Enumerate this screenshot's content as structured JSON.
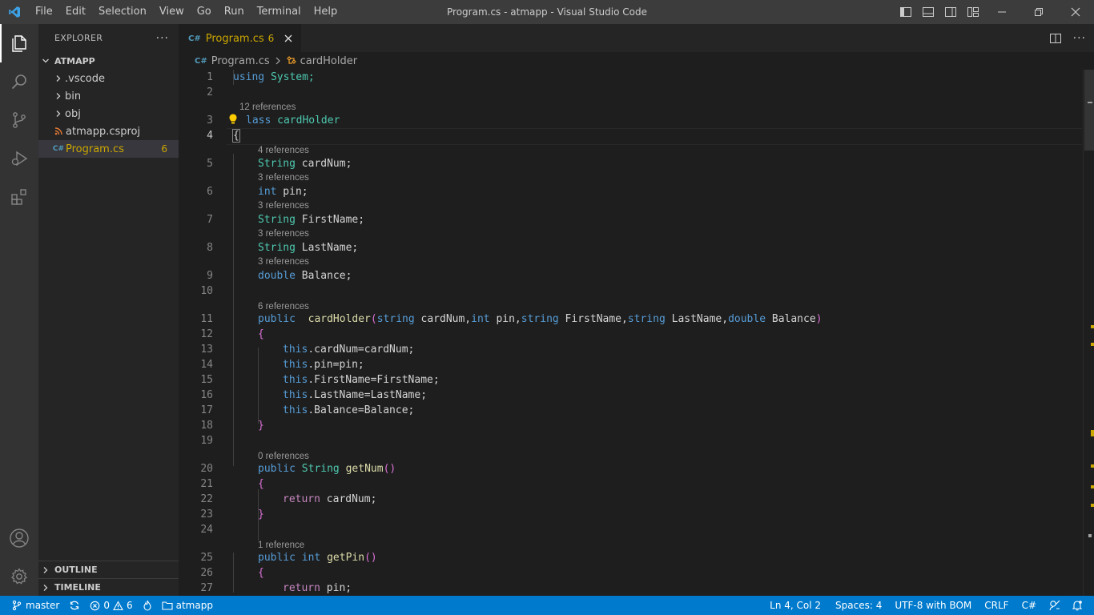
{
  "window": {
    "title": "Program.cs - atmapp - Visual Studio Code",
    "menu": [
      "File",
      "Edit",
      "Selection",
      "View",
      "Go",
      "Run",
      "Terminal",
      "Help"
    ]
  },
  "sidebar": {
    "header": "EXPLORER",
    "more": "···",
    "root": "ATMAPP",
    "items": [
      {
        "label": ".vscode",
        "type": "folder"
      },
      {
        "label": "bin",
        "type": "folder"
      },
      {
        "label": "obj",
        "type": "folder"
      },
      {
        "label": "atmapp.csproj",
        "type": "file",
        "icon": "rss-icon"
      },
      {
        "label": "Program.cs",
        "type": "file",
        "icon": "csharp-icon",
        "badge": "6",
        "selected": true
      }
    ],
    "outline": "OUTLINE",
    "timeline": "TIMELINE"
  },
  "editor": {
    "tab": {
      "icon": "C#",
      "label": "Program.cs",
      "badge": "6"
    },
    "breadcrumb": {
      "icon": "C#",
      "file": "Program.cs",
      "symbol": "cardHolder"
    },
    "lens": {
      "l3": "12 references",
      "l5": "4 references",
      "l6": "3 references",
      "l7": "3 references",
      "l8": "3 references",
      "l9": "3 references",
      "l11": "6 references",
      "l20": "0 references",
      "l25": "1 reference"
    },
    "code": {
      "l1a": "using",
      "l1b": " System;",
      "l3a": "lass",
      "l3b": " cardHolder",
      "l4": "{",
      "l5a": "String",
      "l5b": " cardNum;",
      "l6a": "int",
      "l6b": " pin;",
      "l7a": "String",
      "l7b": " FirstName;",
      "l8a": "String",
      "l8b": " LastName;",
      "l9a": "double",
      "l9b": " Balance;",
      "l11a": "public",
      "l11b": "  cardHolder",
      "l11c": "(",
      "l11d": "string",
      "l11e": " cardNum,",
      "l11f": "int",
      "l11g": " pin,",
      "l11h": "string",
      "l11i": " FirstName,",
      "l11j": "string",
      "l11k": " LastName,",
      "l11l": "double",
      "l11m": " Balance",
      "l11n": ")",
      "l12": "{",
      "l13a": "this",
      "l13b": ".cardNum=cardNum;",
      "l14a": "this",
      "l14b": ".pin=pin;",
      "l15a": "this",
      "l15b": ".FirstName=FirstName;",
      "l16a": "this",
      "l16b": ".LastName=LastName;",
      "l17a": "this",
      "l17b": ".Balance=Balance;",
      "l18": "}",
      "l20a": "public",
      "l20b": " String",
      "l20c": " getNum",
      "l20d": "()",
      "l21": "{",
      "l22a": "return",
      "l22b": " cardNum;",
      "l23": "}",
      "l25a": "public",
      "l25b": " int",
      "l25c": " getPin",
      "l25d": "()",
      "l26": "{",
      "l27a": "return",
      "l27b": " pin;"
    }
  },
  "statusbar": {
    "branch": "master",
    "errors": "0",
    "warnings": "6",
    "folder": "atmapp",
    "position": "Ln 4, Col 2",
    "spaces": "Spaces: 4",
    "encoding": "UTF-8 with BOM",
    "eol": "CRLF",
    "language": "C#"
  },
  "colors": {
    "accent": "#007acc",
    "warning": "#cca700",
    "keyword": "#569cd6",
    "type": "#4ec9b0",
    "bracket": "#da70d6"
  }
}
